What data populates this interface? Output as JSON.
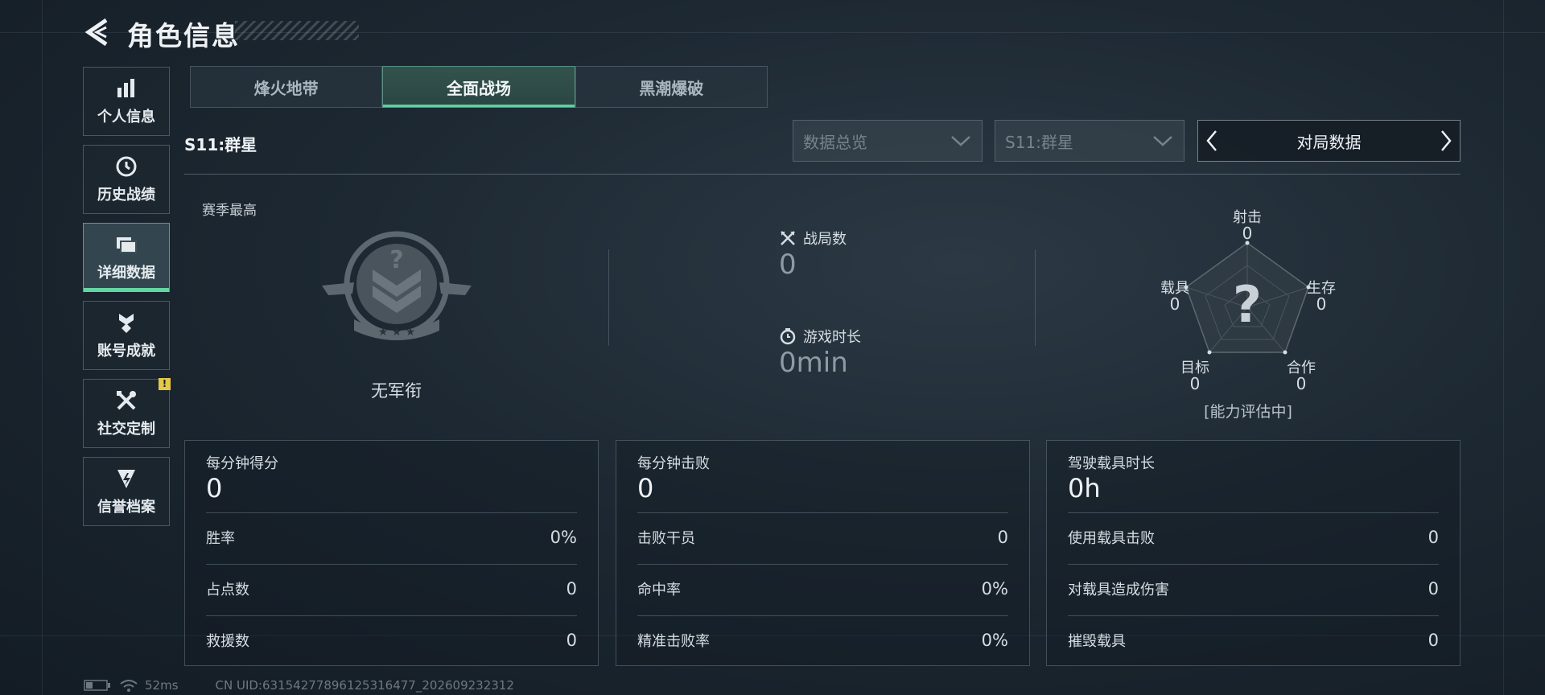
{
  "header": {
    "title": "角色信息"
  },
  "sidebar": {
    "items": [
      {
        "label": "个人信息",
        "icon": "bar-chart-icon"
      },
      {
        "label": "历史战绩",
        "icon": "history-icon"
      },
      {
        "label": "详细数据",
        "icon": "folder-icon",
        "active": true
      },
      {
        "label": "账号成就",
        "icon": "achievement-icon"
      },
      {
        "label": "社交定制",
        "icon": "tools-icon",
        "badge": "!"
      },
      {
        "label": "信誉档案",
        "icon": "credit-icon"
      }
    ]
  },
  "tabs": [
    {
      "label": "烽火地带"
    },
    {
      "label": "全面战场",
      "active": true
    },
    {
      "label": "黑潮爆破"
    }
  ],
  "season": {
    "label": "S11:群星"
  },
  "filters": {
    "data_view": "数据总览",
    "season": "S11:群星",
    "pager_label": "对局数据"
  },
  "season_best": {
    "label": "赛季最高",
    "rank": "无军衔"
  },
  "stats": {
    "matches_label": "战局数",
    "matches_value": "0",
    "playtime_label": "游戏时长",
    "playtime_value": "0min"
  },
  "radar": {
    "status": "[能力评估中]",
    "axes": [
      {
        "label": "射击",
        "value": "0"
      },
      {
        "label": "生存",
        "value": "0"
      },
      {
        "label": "合作",
        "value": "0"
      },
      {
        "label": "目标",
        "value": "0"
      },
      {
        "label": "载具",
        "value": "0"
      }
    ]
  },
  "panels": [
    {
      "title": "每分钟得分",
      "value": "0",
      "rows": [
        {
          "label": "胜率",
          "value": "0%"
        },
        {
          "label": "占点数",
          "value": "0"
        },
        {
          "label": "救援数",
          "value": "0"
        }
      ]
    },
    {
      "title": "每分钟击败",
      "value": "0",
      "rows": [
        {
          "label": "击败干员",
          "value": "0"
        },
        {
          "label": "命中率",
          "value": "0%"
        },
        {
          "label": "精准击败率",
          "value": "0%"
        }
      ]
    },
    {
      "title": "驾驶载具时长",
      "value": "0h",
      "rows": [
        {
          "label": "使用载具击败",
          "value": "0"
        },
        {
          "label": "对载具造成伤害",
          "value": "0"
        },
        {
          "label": "摧毁载具",
          "value": "0"
        }
      ]
    }
  ],
  "footer": {
    "ping": "52ms",
    "uid": "CN UID:631542778961253164​77_202609232312"
  },
  "colors": {
    "accent": "#63d6a2",
    "badge": "#e3c84a"
  }
}
